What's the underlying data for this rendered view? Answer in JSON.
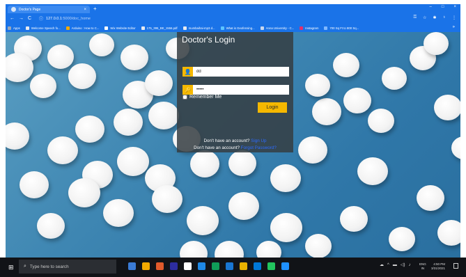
{
  "browser": {
    "tab_title": "Doctor's Page",
    "tab_close": "×",
    "new_tab": "+",
    "window_controls": [
      "–",
      "□",
      "×"
    ],
    "nav_back": "←",
    "nav_forward": "→",
    "nav_reload": "C",
    "url_host": "127.0.0.1",
    "url_path": ":5000/doc_home",
    "toolbar_icons": [
      "⚿",
      "☆",
      "✱",
      "♁",
      "⋮"
    ],
    "bookmarks": [
      {
        "label": "Apps",
        "color": "#9aa7b8"
      },
      {
        "label": "Welcome Speech fo...",
        "color": "#e7eaf0"
      },
      {
        "label": "Arduino : How to C...",
        "color": "#f2a900"
      },
      {
        "label": "Wix Website Editor",
        "color": "#ffffff"
      },
      {
        "label": "175_395_BE_1556.pdf",
        "color": "#e7eaf0"
      },
      {
        "label": "mumbaihai-mp3 d...",
        "color": "#e7eaf0"
      },
      {
        "label": "What is Geofensing...",
        "color": "#5cc4ff"
      },
      {
        "label": "Anna University - C...",
        "color": "#c8d7ee"
      },
      {
        "label": "Instagram",
        "color": "#e1306c"
      },
      {
        "label": "700 Sq Ft to 800 Sq...",
        "color": "#7fb8ff"
      }
    ],
    "bookmarks_more": "»"
  },
  "login": {
    "title": "Doctor's Login",
    "username_value": "dd",
    "password_value": "•••••",
    "user_icon": "👤",
    "key_icon": "🔑",
    "remember_label": "Remember Me",
    "login_button": "Login",
    "account_prompt_1": "Don't have an account?",
    "account_link_1": "Sign Up",
    "account_prompt_2": "Don't have an account?",
    "account_link_2": "Forgot Password?"
  },
  "taskbar": {
    "start_icon": "⊞",
    "search_icon": "⌕",
    "search_placeholder": "Type here to search",
    "taskbar_apps": [
      "#3a7bd5",
      "#f2a900",
      "#e05a2b",
      "#2d2d9f",
      "#ffffff",
      "#1e88e5",
      "#0f9d58",
      "#1976d2",
      "#e8b100",
      "#0078d7",
      "#22c55e",
      "#1e90ff"
    ],
    "tray_icons": [
      "☁",
      "^",
      "▬",
      "◁)",
      "♪"
    ],
    "lang_line1": "ENG",
    "lang_line2": "IN",
    "time": "4:50 PM",
    "date": "3/31/2021"
  },
  "colors": {
    "accent": "#f5b800",
    "chrome": "#1a73e8",
    "taskbar": "#111317"
  }
}
